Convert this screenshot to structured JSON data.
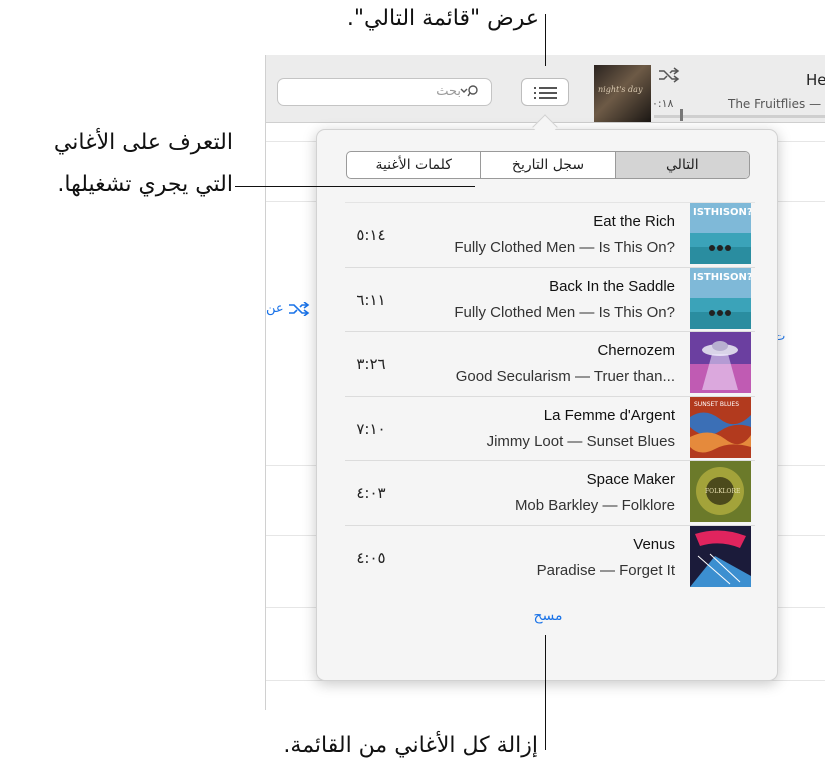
{
  "callouts": {
    "top": "عرض \"قائمة التالي\".",
    "left_line1": "التعرف على الأغاني",
    "left_line2": "التي يجري تشغيلها.",
    "bottom": "إزالة كل الأغاني من القائمة."
  },
  "toolbar": {
    "search_placeholder": "بحث",
    "now_playing": {
      "title": "He",
      "artist": "The Fruitflies —",
      "time": "٠:١٨",
      "progress": 0.13,
      "art_text": "night's day"
    }
  },
  "background": {
    "shuffle_text": "عن"
  },
  "popover": {
    "tabs": [
      {
        "label": "كلمات الأغنية",
        "active": false
      },
      {
        "label": "سجل التاريخ",
        "active": false
      },
      {
        "label": "التالي",
        "active": true
      }
    ],
    "tracks": [
      {
        "title": "Eat the Rich",
        "subtitle": "Fully Clothed Men — Is This On?",
        "time": "٥:١٤",
        "art": "isthison"
      },
      {
        "title": "Back In the Saddle",
        "subtitle": "Fully Clothed Men — Is This On?",
        "time": "٦:١١",
        "art": "isthison"
      },
      {
        "title": "Chernozem",
        "subtitle": "Good Secularism — Truer than...",
        "time": "٣:٢٦",
        "art": "ufo"
      },
      {
        "title": "La Femme d'Argent",
        "subtitle": "Jimmy Loot — Sunset Blues",
        "time": "٧:١٠",
        "art": "sunset-blues"
      },
      {
        "title": "Space Maker",
        "subtitle": "Mob Barkley — Folklore",
        "time": "٤:٠٣",
        "art": "folklore"
      },
      {
        "title": "Venus",
        "subtitle": "Paradise — Forget It",
        "time": "٤:٠٥",
        "art": "forget-it"
      }
    ],
    "clear_label": "مسح"
  },
  "colors": {
    "accent": "#1a73e8",
    "popover_bg": "#f5f5f5",
    "toolbar_bg": "#ececec"
  }
}
